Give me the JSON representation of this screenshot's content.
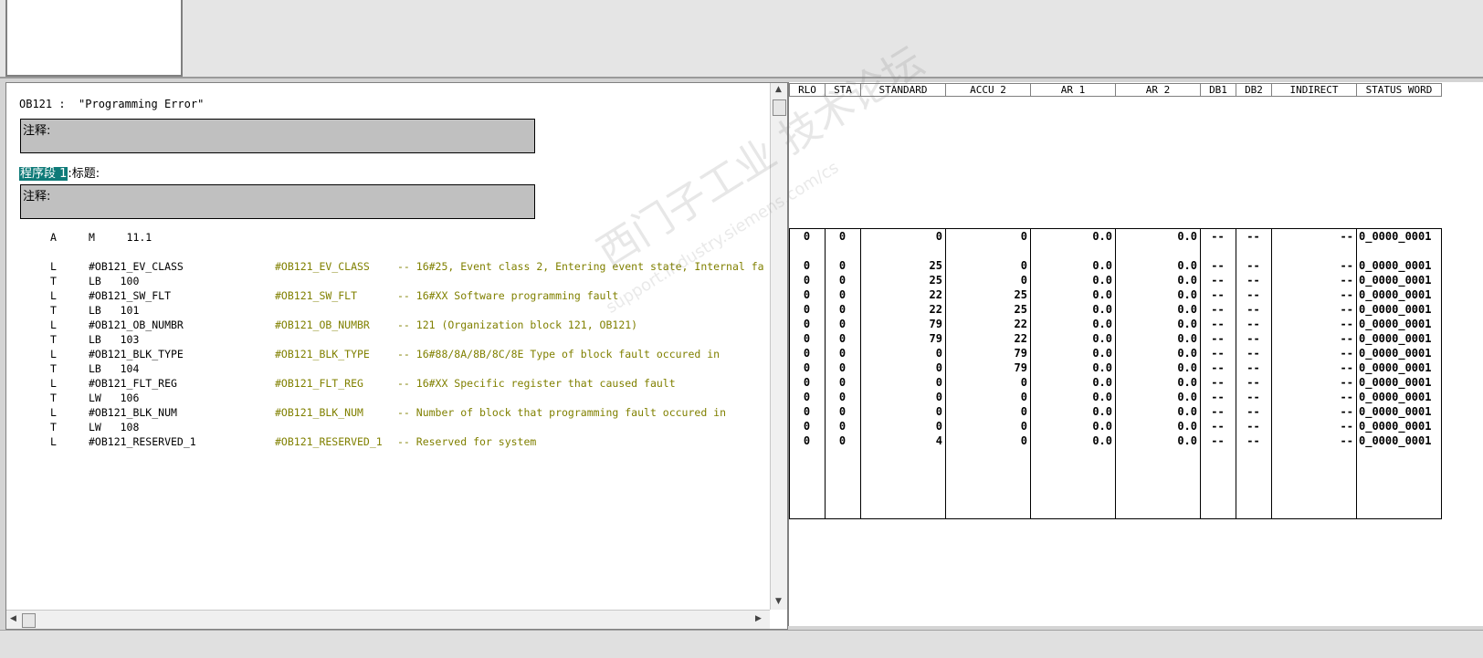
{
  "block": {
    "title": "OB121 :  \"Programming Error\"",
    "comment_label_1": "注释:",
    "network_label": "程序段 1",
    "network_title": ":标题:",
    "comment_label_2": "注释:"
  },
  "code_lines": [
    {
      "op": "A",
      "arg": "M     11.1",
      "sym": "",
      "cmt": ""
    },
    {
      "op": "",
      "arg": "",
      "sym": "",
      "cmt": ""
    },
    {
      "op": "L",
      "arg": "#OB121_EV_CLASS",
      "sym": "#OB121_EV_CLASS",
      "cmt": "-- 16#25, Event class 2, Entering event state, Internal fa"
    },
    {
      "op": "T",
      "arg": "LB   100",
      "sym": "",
      "cmt": ""
    },
    {
      "op": "L",
      "arg": "#OB121_SW_FLT",
      "sym": "#OB121_SW_FLT",
      "cmt": "-- 16#XX Software programming fault"
    },
    {
      "op": "T",
      "arg": "LB   101",
      "sym": "",
      "cmt": ""
    },
    {
      "op": "L",
      "arg": "#OB121_OB_NUMBR",
      "sym": "#OB121_OB_NUMBR",
      "cmt": "-- 121 (Organization block 121, OB121)"
    },
    {
      "op": "T",
      "arg": "LB   103",
      "sym": "",
      "cmt": ""
    },
    {
      "op": "L",
      "arg": "#OB121_BLK_TYPE",
      "sym": "#OB121_BLK_TYPE",
      "cmt": "-- 16#88/8A/8B/8C/8E Type of block fault occured in"
    },
    {
      "op": "T",
      "arg": "LB   104",
      "sym": "",
      "cmt": ""
    },
    {
      "op": "L",
      "arg": "#OB121_FLT_REG",
      "sym": "#OB121_FLT_REG",
      "cmt": "-- 16#XX Specific register that caused fault"
    },
    {
      "op": "T",
      "arg": "LW   106",
      "sym": "",
      "cmt": ""
    },
    {
      "op": "L",
      "arg": "#OB121_BLK_NUM",
      "sym": "#OB121_BLK_NUM",
      "cmt": "-- Number of block that programming fault occured in"
    },
    {
      "op": "T",
      "arg": "LW   108",
      "sym": "",
      "cmt": ""
    },
    {
      "op": "L",
      "arg": "#OB121_RESERVED_1",
      "sym": "#OB121_RESERVED_1",
      "cmt": "-- Reserved for system"
    }
  ],
  "status_table": {
    "headers": [
      "RLO",
      "STA",
      "STANDARD",
      "ACCU 2",
      "AR 1",
      "AR 2",
      "DB1",
      "DB2",
      "INDIRECT",
      "STATUS WORD"
    ],
    "rows": [
      [
        "0",
        "0",
        "0",
        "0",
        "0.0",
        "0.0",
        "--",
        "--",
        "--",
        "0_0000_0001"
      ],
      [
        "",
        "",
        "",
        "",
        "",
        "",
        "",
        "",
        "",
        ""
      ],
      [
        "0",
        "0",
        "25",
        "0",
        "0.0",
        "0.0",
        "--",
        "--",
        "--",
        "0_0000_0001"
      ],
      [
        "0",
        "0",
        "25",
        "0",
        "0.0",
        "0.0",
        "--",
        "--",
        "--",
        "0_0000_0001"
      ],
      [
        "0",
        "0",
        "22",
        "25",
        "0.0",
        "0.0",
        "--",
        "--",
        "--",
        "0_0000_0001"
      ],
      [
        "0",
        "0",
        "22",
        "25",
        "0.0",
        "0.0",
        "--",
        "--",
        "--",
        "0_0000_0001"
      ],
      [
        "0",
        "0",
        "79",
        "22",
        "0.0",
        "0.0",
        "--",
        "--",
        "--",
        "0_0000_0001"
      ],
      [
        "0",
        "0",
        "79",
        "22",
        "0.0",
        "0.0",
        "--",
        "--",
        "--",
        "0_0000_0001"
      ],
      [
        "0",
        "0",
        "0",
        "79",
        "0.0",
        "0.0",
        "--",
        "--",
        "--",
        "0_0000_0001"
      ],
      [
        "0",
        "0",
        "0",
        "79",
        "0.0",
        "0.0",
        "--",
        "--",
        "--",
        "0_0000_0001"
      ],
      [
        "0",
        "0",
        "0",
        "0",
        "0.0",
        "0.0",
        "--",
        "--",
        "--",
        "0_0000_0001"
      ],
      [
        "0",
        "0",
        "0",
        "0",
        "0.0",
        "0.0",
        "--",
        "--",
        "--",
        "0_0000_0001"
      ],
      [
        "0",
        "0",
        "0",
        "0",
        "0.0",
        "0.0",
        "--",
        "--",
        "--",
        "0_0000_0001"
      ],
      [
        "0",
        "0",
        "0",
        "0",
        "0.0",
        "0.0",
        "--",
        "--",
        "--",
        "0_0000_0001"
      ],
      [
        "0",
        "0",
        "4",
        "0",
        "0.0",
        "0.0",
        "--",
        "--",
        "--",
        "0_0000_0001"
      ]
    ]
  },
  "watermark": {
    "line1": "西门子工业 技术论坛",
    "line2": "support.industry.siemens.com/cs"
  }
}
